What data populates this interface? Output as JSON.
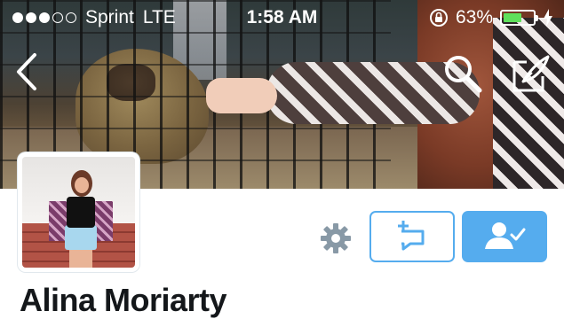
{
  "status_bar": {
    "carrier": "Sprint",
    "network": "LTE",
    "time": "1:58 AM",
    "battery_percent": "63%",
    "battery_level": 0.63,
    "signal_bars": 3,
    "signal_total": 5
  },
  "nav": {
    "back_icon": "chevron-left-icon",
    "search_icon": "search-icon",
    "compose_icon": "compose-icon"
  },
  "profile": {
    "name": "Alina Moriarty",
    "actions": {
      "settings_icon": "gear-icon",
      "retweet_icon": "add-to-list-icon",
      "follow_icon": "following-person-icon"
    }
  },
  "colors": {
    "accent": "#55acee",
    "battery": "#5fe05b",
    "text": "#14171a"
  }
}
